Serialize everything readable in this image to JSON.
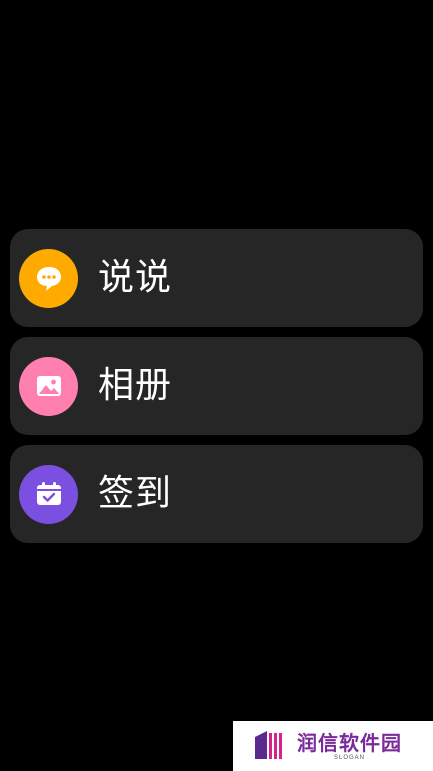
{
  "menu": {
    "items": [
      {
        "label": "说说",
        "icon": "chat-bubble-icon",
        "color": "#FFAA00"
      },
      {
        "label": "相册",
        "icon": "photo-icon",
        "color": "#FF7FAF"
      },
      {
        "label": "签到",
        "icon": "calendar-check-icon",
        "color": "#7B4FE0"
      }
    ]
  },
  "watermark": {
    "name": "润信软件园",
    "slogan": "SLOGAN",
    "icon": "watermark-logo"
  }
}
